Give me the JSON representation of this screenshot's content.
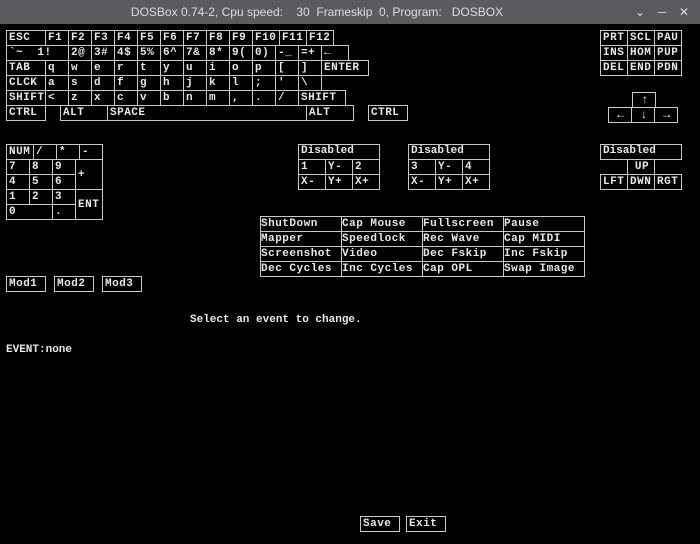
{
  "titlebar": {
    "text": "DOSBox 0.74-2, Cpu speed:    30  Frameskip  0, Program:   DOSBOX"
  },
  "main_keyboard": {
    "row0": [
      "ESC",
      "F1",
      "F2",
      "F3",
      "F4",
      "F5",
      "F6",
      "F7",
      "F8",
      "F9",
      "F10",
      "F11",
      "F12"
    ],
    "row1": [
      "`~  1!",
      "2@",
      "3#",
      "4$",
      "5%",
      "6^",
      "7&",
      "8*",
      "9(",
      "0)",
      "-_",
      "=+",
      "←"
    ],
    "row2": [
      "TAB",
      "q",
      "w",
      "e",
      "r",
      "t",
      "y",
      "u",
      "i",
      "o",
      "p",
      "[",
      "]",
      "ENTER"
    ],
    "row3": [
      "CLCK",
      "a",
      "s",
      "d",
      "f",
      "g",
      "h",
      "j",
      "k",
      "l",
      ";",
      "'",
      "\\"
    ],
    "row4": [
      "SHIFT",
      "<",
      "z",
      "x",
      "c",
      "v",
      "b",
      "n",
      "m",
      ",",
      ".",
      "/",
      "SHIFT"
    ],
    "row5": [
      "CTRL",
      "ALT",
      "SPACE",
      "ALT",
      "CTRL"
    ]
  },
  "nav_cluster": {
    "row0": [
      "PRT",
      "SCL",
      "PAU"
    ],
    "row1": [
      "INS",
      "HOM",
      "PUP"
    ],
    "row2": [
      "DEL",
      "END",
      "PDN"
    ]
  },
  "arrows": {
    "up": "↑",
    "left": "←",
    "down": "↓",
    "right": "→"
  },
  "numpad": {
    "header": [
      "NUM",
      "/",
      "*",
      "-"
    ],
    "r1": [
      "7",
      "8",
      "9",
      "+"
    ],
    "r2": [
      "4",
      "5",
      "6"
    ],
    "r3": [
      "1",
      "2",
      "3",
      "ENT"
    ],
    "r4": [
      "0",
      ".",
      ""
    ]
  },
  "joy1": {
    "label": "Disabled",
    "r1": [
      "1",
      "Y-",
      "2"
    ],
    "r2": [
      "X-",
      "Y+",
      "X+"
    ]
  },
  "joy2": {
    "label": "Disabled",
    "r1": [
      "3",
      "Y-",
      "4"
    ],
    "r2": [
      "X-",
      "Y+",
      "X+"
    ]
  },
  "joy3": {
    "label": "Disabled",
    "r1": [
      "UP"
    ],
    "r2": [
      "LFT",
      "DWN",
      "RGT"
    ]
  },
  "mods": [
    "Mod1",
    "Mod2",
    "Mod3"
  ],
  "ftable": {
    "r0": [
      "ShutDown",
      "Cap Mouse",
      "Fullscreen",
      "Pause"
    ],
    "r1": [
      "Mapper",
      "Speedlock",
      "Rec Wave",
      "Cap MIDI"
    ],
    "r2": [
      "Screenshot",
      "Video",
      "Dec Fskip",
      "Inc Fskip"
    ],
    "r3": [
      "Dec Cycles",
      "Inc Cycles",
      "Cap OPL",
      "Swap Image"
    ]
  },
  "message": "Select an event to change.",
  "event_line": "EVENT:none",
  "footer": {
    "save": "Save",
    "exit": "Exit"
  }
}
